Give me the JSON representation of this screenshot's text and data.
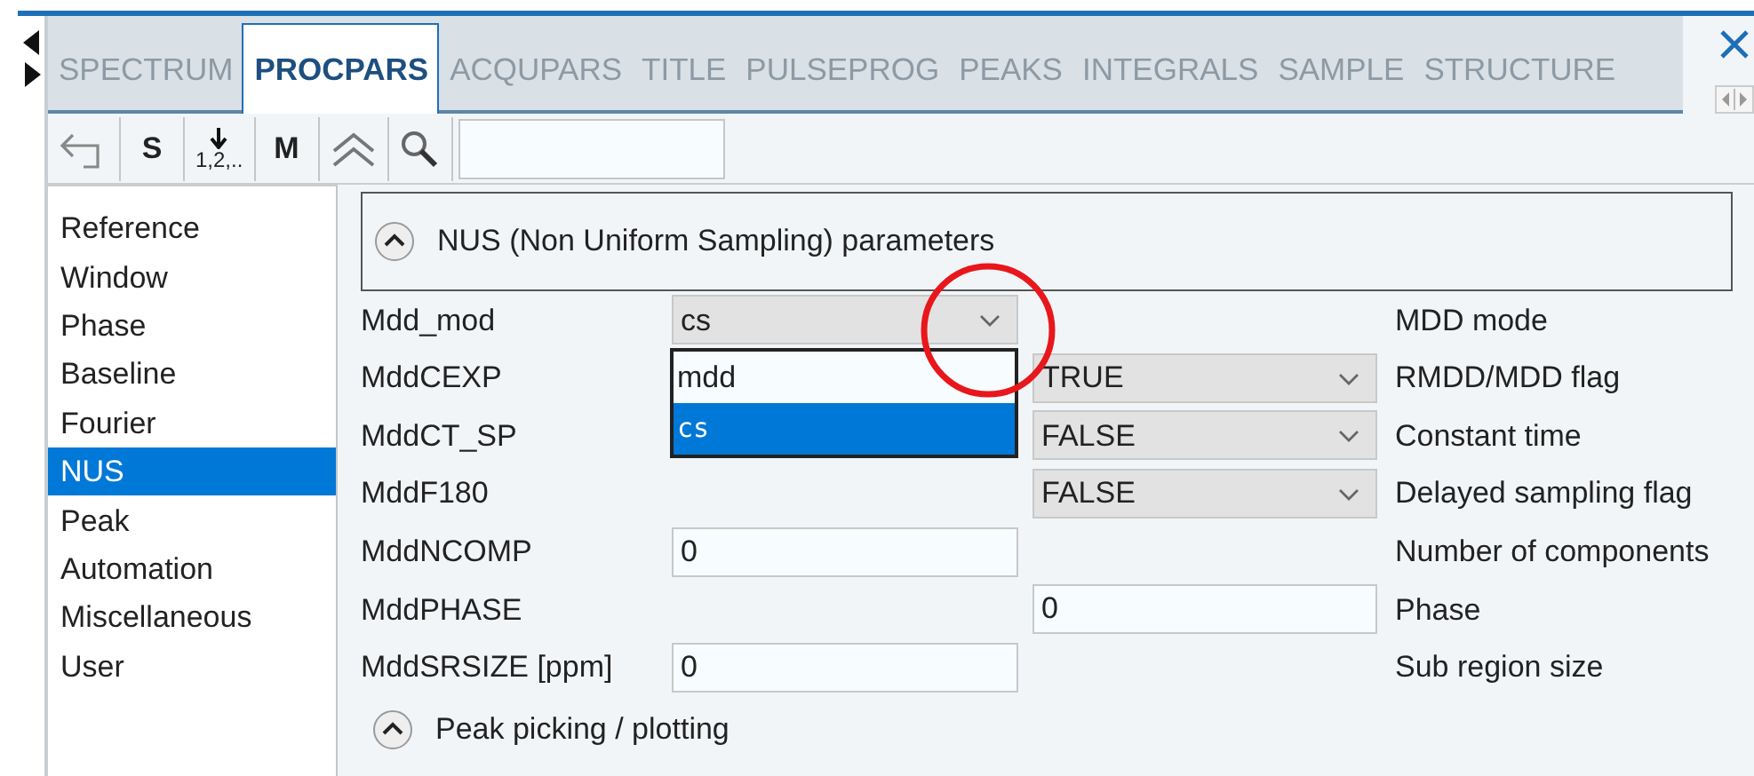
{
  "tabs": [
    {
      "label": "SPECTRUM",
      "selected": false
    },
    {
      "label": "PROCPARS",
      "selected": true
    },
    {
      "label": "ACQUPARS",
      "selected": false
    },
    {
      "label": "TITLE",
      "selected": false
    },
    {
      "label": "PULSEPROG",
      "selected": false
    },
    {
      "label": "PEAKS",
      "selected": false
    },
    {
      "label": "INTEGRALS",
      "selected": false
    },
    {
      "label": "SAMPLE",
      "selected": false
    },
    {
      "label": "STRUCTURE",
      "selected": false
    }
  ],
  "toolbar": [
    {
      "kind": "undo"
    },
    {
      "kind": "text",
      "label": "S"
    },
    {
      "kind": "numbering",
      "label": "1,2,.."
    },
    {
      "kind": "text",
      "label": "M"
    },
    {
      "kind": "collapse"
    },
    {
      "kind": "search"
    }
  ],
  "sidebar": {
    "items": [
      {
        "label": "Reference",
        "selected": false
      },
      {
        "label": "Window",
        "selected": false
      },
      {
        "label": "Phase",
        "selected": false
      },
      {
        "label": "Baseline",
        "selected": false
      },
      {
        "label": "Fourier",
        "selected": false
      },
      {
        "label": "NUS",
        "selected": true
      },
      {
        "label": "Peak",
        "selected": false
      },
      {
        "label": "Automation",
        "selected": false
      },
      {
        "label": "Miscellaneous",
        "selected": false
      },
      {
        "label": "User",
        "selected": false
      }
    ]
  },
  "section": {
    "title": "NUS (Non Uniform Sampling) parameters",
    "expanded": true
  },
  "params": [
    {
      "name": "Mdd_mod",
      "left_control": {
        "kind": "select",
        "value": "cs",
        "open": true,
        "options": [
          {
            "label": "mdd",
            "selected": false
          },
          {
            "label": "cs",
            "selected": true
          }
        ]
      },
      "description": "MDD mode"
    },
    {
      "name": "MddCEXP",
      "right_control": {
        "kind": "select",
        "value": "TRUE"
      },
      "description": "RMDD/MDD flag"
    },
    {
      "name": "MddCT_SP",
      "right_control": {
        "kind": "select",
        "value": "FALSE"
      },
      "description": "Constant time"
    },
    {
      "name": "MddF180",
      "right_control": {
        "kind": "select",
        "value": "FALSE"
      },
      "description": "Delayed sampling flag"
    },
    {
      "name": "MddNCOMP",
      "left_control": {
        "kind": "text",
        "value": "0"
      },
      "description": "Number of components"
    },
    {
      "name": "MddPHASE",
      "right_control": {
        "kind": "text",
        "value": "0"
      },
      "description": "Phase"
    },
    {
      "name": "MddSRSIZE [ppm]",
      "left_control": {
        "kind": "text",
        "value": "0"
      },
      "description": "Sub region size"
    }
  ],
  "next_section": {
    "title": "Peak picking / plotting",
    "expanded": true
  },
  "annotation": {
    "kind": "circle"
  }
}
